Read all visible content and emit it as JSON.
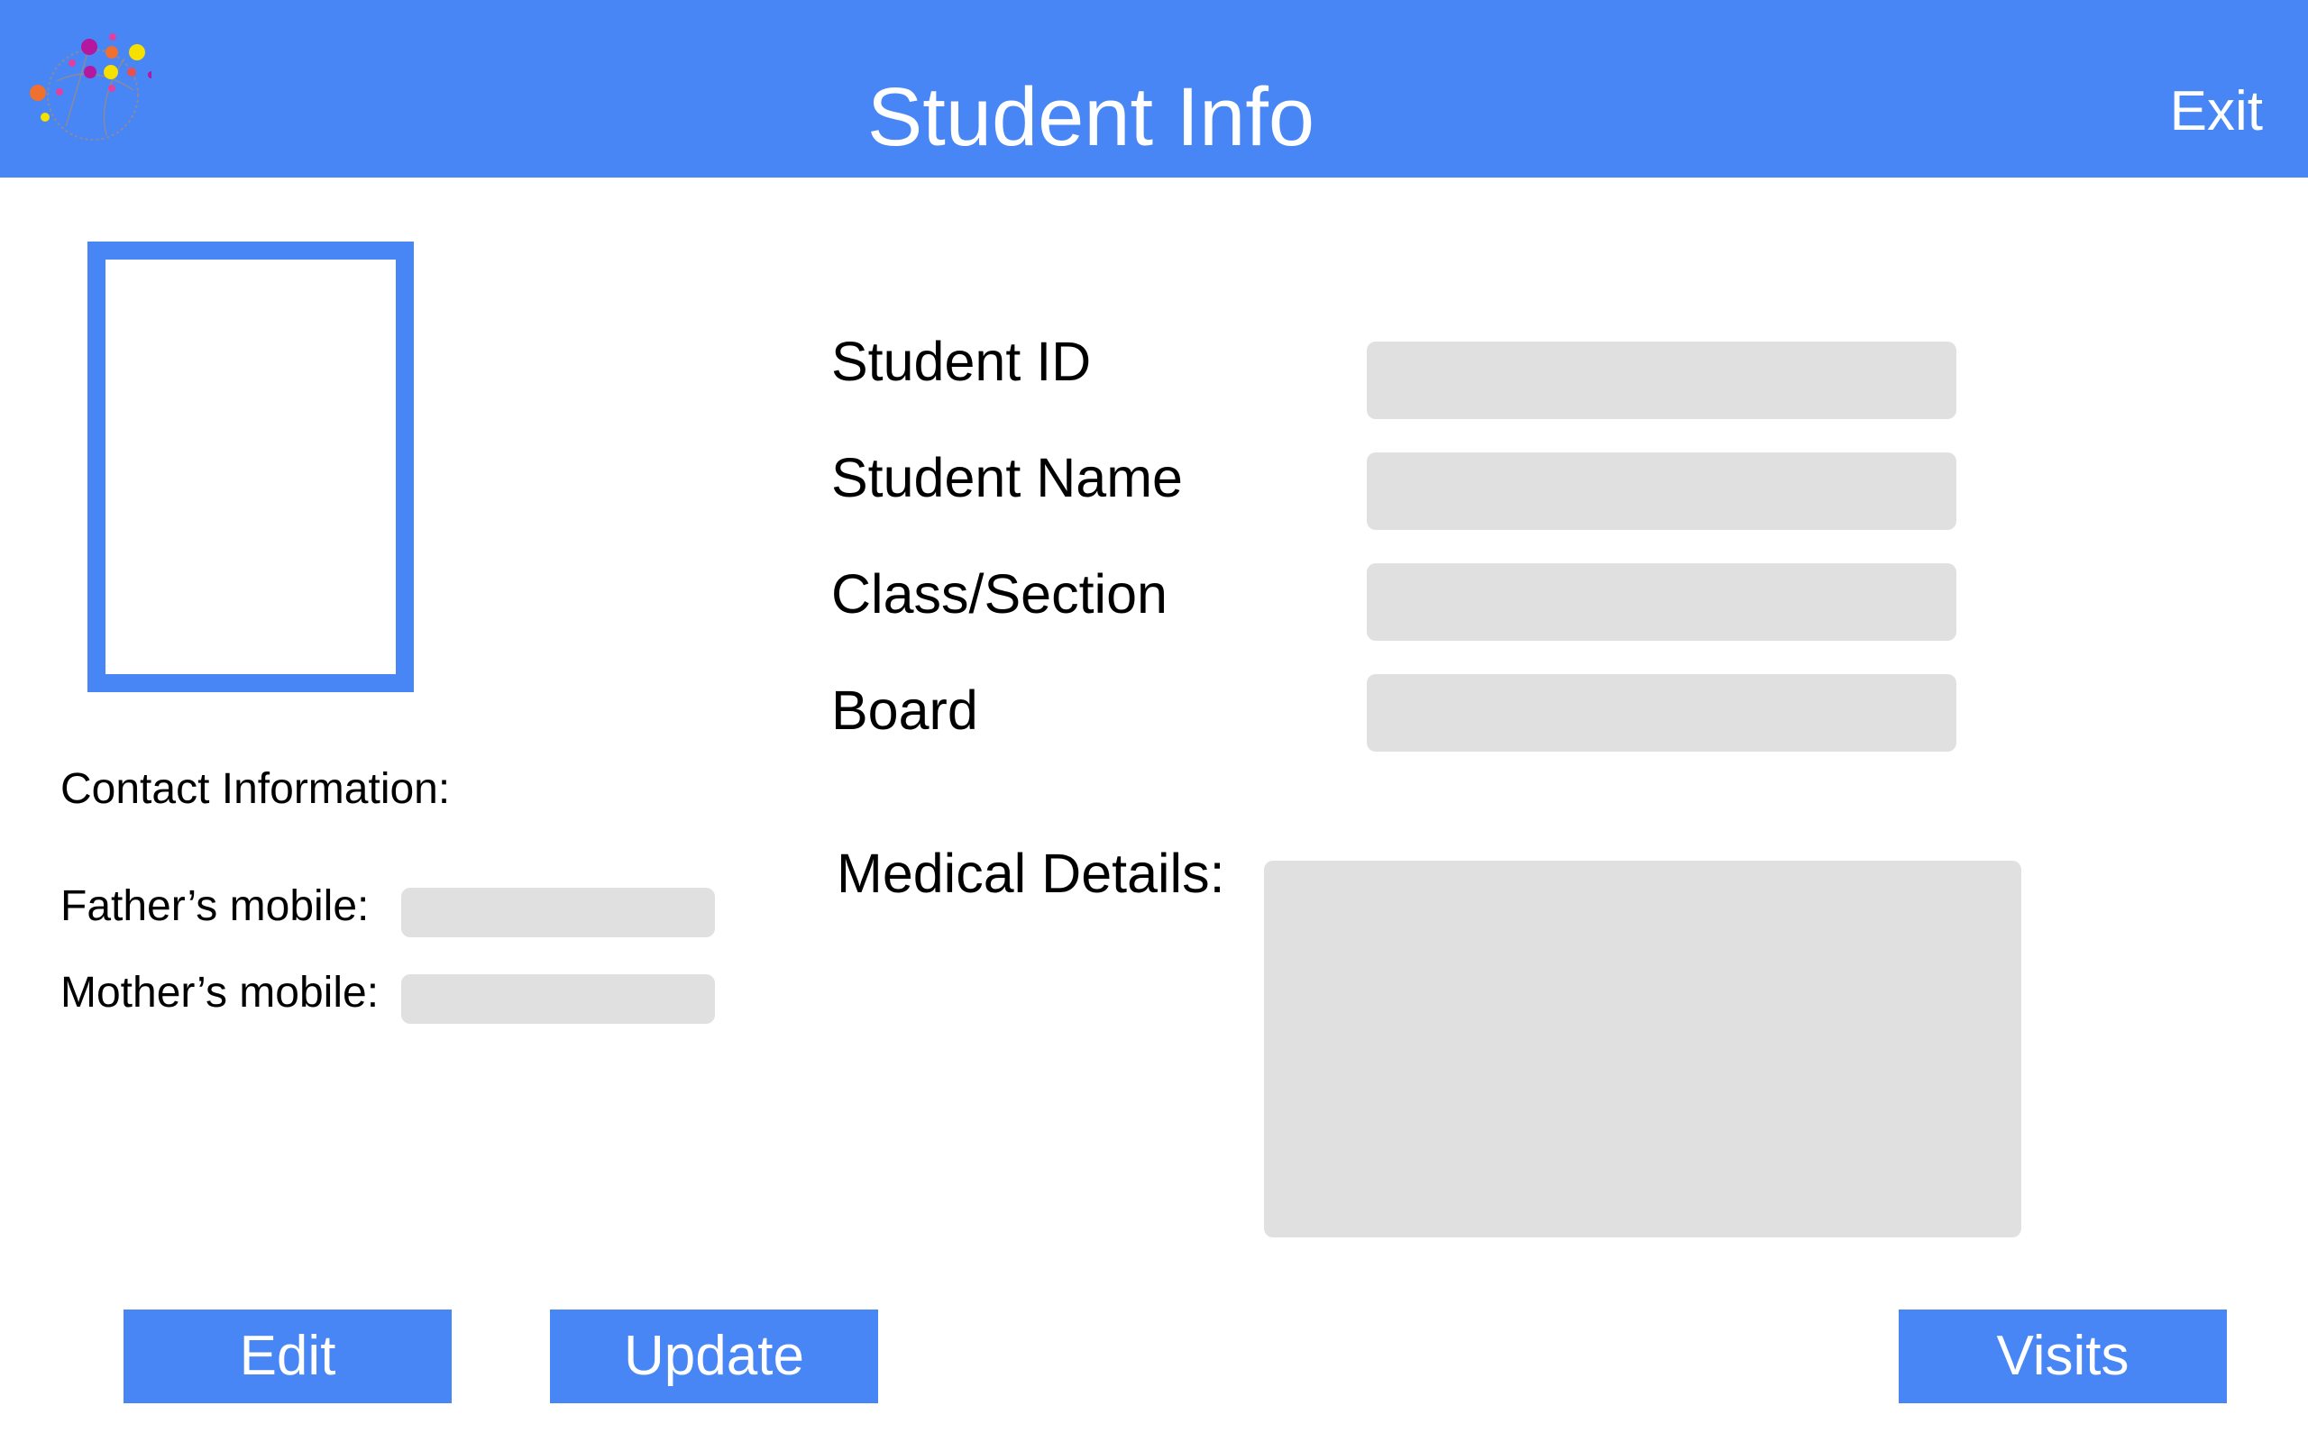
{
  "header": {
    "title": "Student Info",
    "exit_label": "Exit",
    "logo_icon": "logo-icon",
    "color": "#4786F4"
  },
  "profile": {
    "photo_icon": "photo-placeholder-icon"
  },
  "student_fields": [
    {
      "label": "Student ID",
      "value": ""
    },
    {
      "label": "Student Name",
      "value": ""
    },
    {
      "label": "Class/Section",
      "value": ""
    },
    {
      "label": "Board",
      "value": ""
    }
  ],
  "contact": {
    "heading": "Contact Information:",
    "fathers_mobile_label": "Father’s mobile:",
    "fathers_mobile_value": "",
    "mothers_mobile_label": "Mother’s mobile:",
    "mothers_mobile_value": ""
  },
  "medical": {
    "label": "Medical Details:",
    "value": ""
  },
  "actions": {
    "edit_label": "Edit",
    "update_label": "Update",
    "visits_label": "Visits"
  },
  "colors": {
    "accent": "#4786F4",
    "field_bg": "#E0E0E0"
  }
}
